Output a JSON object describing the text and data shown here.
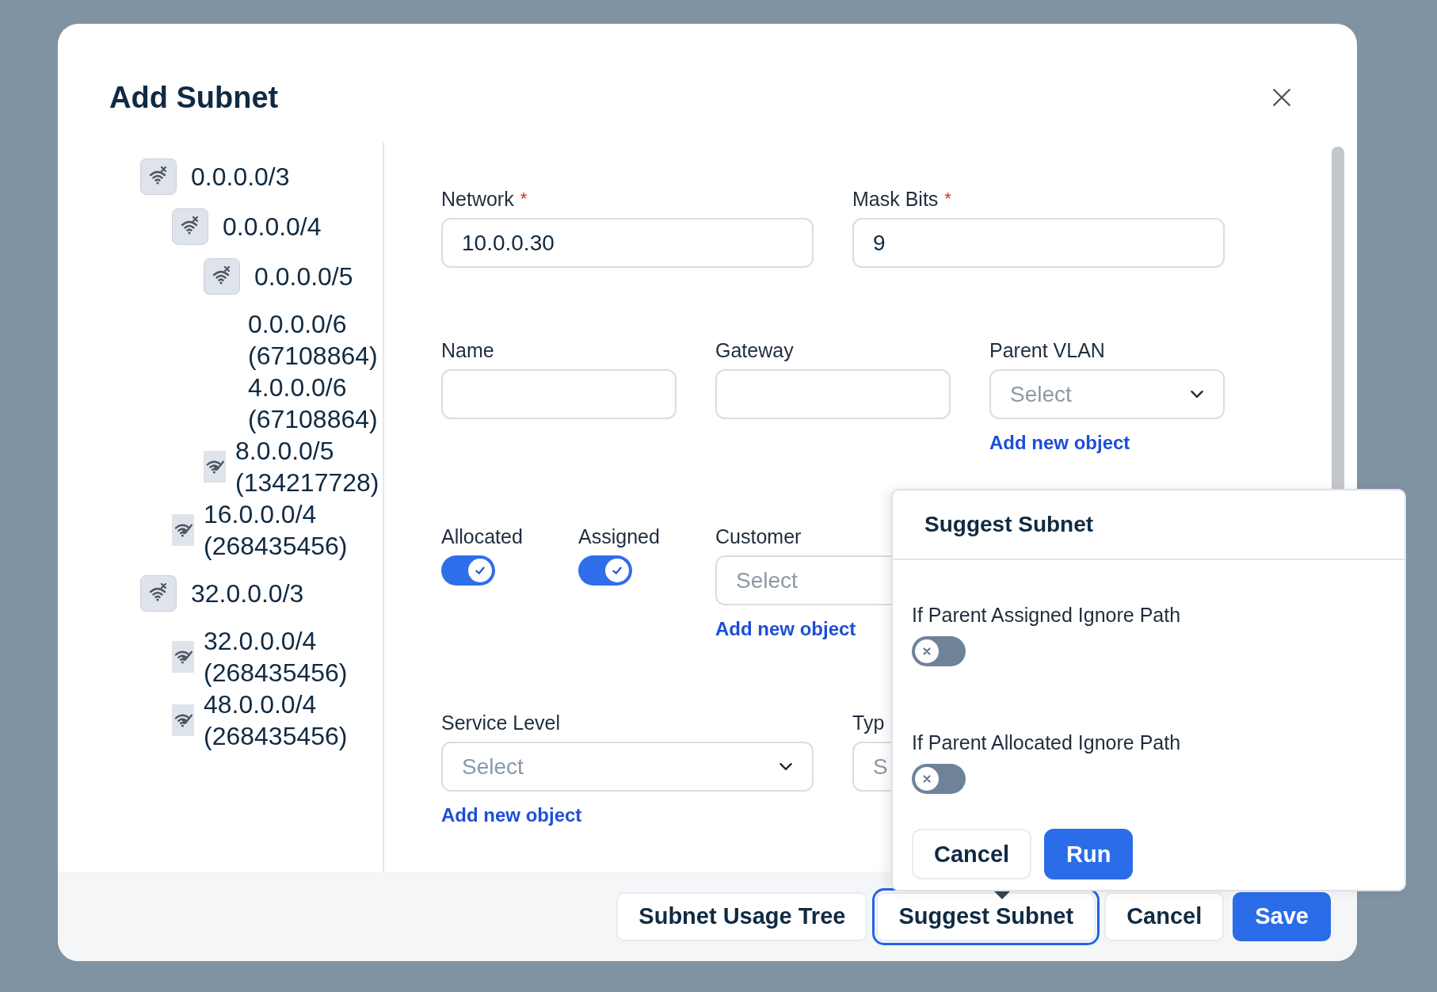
{
  "dialog": {
    "title": "Add Subnet"
  },
  "tree": [
    {
      "label": "0.0.0.0/3",
      "kind": "parent",
      "children": [
        {
          "label": "0.0.0.0/4",
          "kind": "parent",
          "children": [
            {
              "label": "0.0.0.0/5",
              "kind": "parent",
              "children": [
                {
                  "label": "0.0.0.0/6 (67108864)",
                  "kind": "free"
                },
                {
                  "label": "4.0.0.0/6 (67108864)",
                  "kind": "free"
                }
              ]
            },
            {
              "label": "8.0.0.0/5 (134217728)",
              "kind": "used"
            }
          ]
        },
        {
          "label": "16.0.0.0/4 (268435456)",
          "kind": "used"
        }
      ]
    },
    {
      "label": "32.0.0.0/3",
      "kind": "parent",
      "children": [
        {
          "label": "32.0.0.0/4 (268435456)",
          "kind": "used"
        },
        {
          "label": "48.0.0.0/4 (268435456)",
          "kind": "used"
        }
      ]
    }
  ],
  "form": {
    "rows": [
      {
        "fields": [
          {
            "label": "Network",
            "required_mark": "*",
            "kind": "input",
            "value": "10.0.0.30"
          },
          {
            "label": "Mask Bits",
            "required_mark": "*",
            "kind": "input",
            "value": "9"
          }
        ]
      },
      {
        "fields": [
          {
            "label": "Name",
            "kind": "input"
          },
          {
            "label": "Gateway",
            "kind": "input"
          },
          {
            "label": "Parent VLAN",
            "kind": "select",
            "placeholder": "Select",
            "link": "Add new object"
          }
        ]
      },
      {
        "fields": [
          {
            "label": "Allocated",
            "kind": "toggle",
            "on": true
          },
          {
            "label": "Assigned",
            "kind": "toggle",
            "on": true
          },
          {
            "label": "Customer",
            "kind": "select",
            "placeholder": "Select",
            "covered": true,
            "link": "Add new object"
          }
        ]
      },
      {
        "fields": [
          {
            "label": "Service Level",
            "kind": "select",
            "placeholder": "Select",
            "link": "Add new object"
          },
          {
            "label": "Typ",
            "kind": "select",
            "placeholder": "S",
            "covered": true
          }
        ]
      }
    ]
  },
  "suggest_popover": {
    "title": "Suggest Subnet",
    "options": [
      {
        "label": "If Parent Assigned Ignore Path",
        "on": false
      },
      {
        "label": "If Parent Allocated Ignore Path",
        "on": false
      }
    ],
    "buttons": [
      {
        "label": "Cancel",
        "kind": "default"
      },
      {
        "label": "Run",
        "kind": "primary"
      }
    ]
  },
  "footer_buttons": [
    {
      "label": "Subnet Usage Tree",
      "kind": "default",
      "focused": false
    },
    {
      "label": "Suggest Subnet",
      "kind": "default",
      "focused": true
    },
    {
      "label": "Cancel",
      "kind": "default",
      "focused": false
    },
    {
      "label": "Save",
      "kind": "primary",
      "focused": false
    }
  ]
}
